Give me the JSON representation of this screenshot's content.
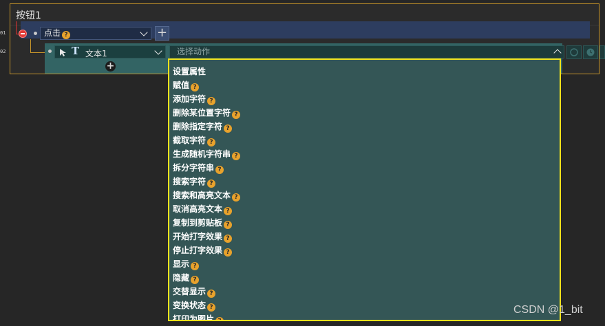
{
  "panel": {
    "title": "按钮1"
  },
  "rows": [
    {
      "number": "01",
      "trigger": "点击",
      "trigger_help": "?"
    },
    {
      "number": "02",
      "target": "文本1",
      "action_placeholder": "选择动作"
    }
  ],
  "add_button": "+",
  "add_circle": "+",
  "actions": [
    {
      "label": "设置属性",
      "help": ""
    },
    {
      "label": "赋值",
      "help": "?"
    },
    {
      "label": "添加字符",
      "help": "?"
    },
    {
      "label": "删除某位置字符",
      "help": "?"
    },
    {
      "label": "删除指定字符",
      "help": "?"
    },
    {
      "label": "截取字符",
      "help": "?"
    },
    {
      "label": "生成随机字符串",
      "help": "?"
    },
    {
      "label": "拆分字符串",
      "help": "?"
    },
    {
      "label": "搜索字符",
      "help": "?"
    },
    {
      "label": "搜索和高亮文本",
      "help": "?"
    },
    {
      "label": "取消高亮文本",
      "help": "?"
    },
    {
      "label": "复制到剪贴板",
      "help": "?"
    },
    {
      "label": "开始打字效果",
      "help": "?"
    },
    {
      "label": "停止打字效果",
      "help": "?"
    },
    {
      "label": "显示",
      "help": "?"
    },
    {
      "label": "隐藏",
      "help": "?"
    },
    {
      "label": "交替显示",
      "help": "?"
    },
    {
      "label": "变换状态",
      "help": "?"
    },
    {
      "label": "打印为图片",
      "help": "?"
    }
  ],
  "watermark": "CSDN @1_bit",
  "colors": {
    "accent_border": "#c8962a",
    "highlight": "#f2e21a",
    "row1_bg": "#2d3d5f",
    "row2_bg": "#336464",
    "help_badge": "#e8a22c",
    "delete_dot": "#e13a36"
  }
}
